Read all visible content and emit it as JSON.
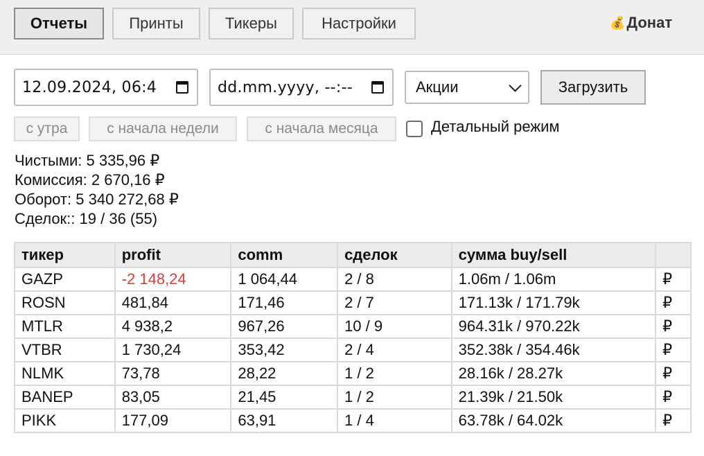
{
  "nav": {
    "tabs": [
      {
        "label": "Отчеты",
        "active": true
      },
      {
        "label": "Принты",
        "active": false
      },
      {
        "label": "Тикеры",
        "active": false
      },
      {
        "label": "Настройки",
        "active": false
      }
    ],
    "donate": {
      "icon": "money-bag-icon",
      "label": "Донат"
    }
  },
  "filters": {
    "date_from": "12.09.2024, 06:4",
    "date_to_placeholder": "dd.mm.yyyy, --:--",
    "instrument_select": "Акции",
    "load_button": "Загрузить",
    "quick_ranges": [
      "с утра",
      "с начала недели",
      "с начала месяца"
    ],
    "detailed_mode": {
      "label": "Детальный режим",
      "checked": false
    }
  },
  "summary": {
    "net_label": "Чистыми:",
    "net_value": "5 335,96 ₽",
    "commission_label": "Комиссия:",
    "commission_value": "2 670,16 ₽",
    "turnover_label": "Оборот:",
    "turnover_value": "5 340 272,68 ₽",
    "deals_label": "Сделок::",
    "deals_value": "19 / 36 (55)"
  },
  "table": {
    "headers": [
      "тикер",
      "profit",
      "comm",
      "сделок",
      "сумма buy/sell",
      ""
    ],
    "rows": [
      {
        "ticker": "GAZP",
        "profit": "-2 148,24",
        "comm": "1 064,44",
        "deals": "2 / 8",
        "sum": "1.06m / 1.06m",
        "cur": "₽",
        "negative": true
      },
      {
        "ticker": "ROSN",
        "profit": "481,84",
        "comm": "171,46",
        "deals": "2 / 7",
        "sum": "171.13k / 171.79k",
        "cur": "₽",
        "negative": false
      },
      {
        "ticker": "MTLR",
        "profit": "4 938,2",
        "comm": "967,26",
        "deals": "10 / 9",
        "sum": "964.31k / 970.22k",
        "cur": "₽",
        "negative": false
      },
      {
        "ticker": "VTBR",
        "profit": "1 730,24",
        "comm": "353,42",
        "deals": "2 / 4",
        "sum": "352.38k / 354.46k",
        "cur": "₽",
        "negative": false
      },
      {
        "ticker": "NLMK",
        "profit": "73,78",
        "comm": "28,22",
        "deals": "1 / 2",
        "sum": "28.16k / 28.27k",
        "cur": "₽",
        "negative": false
      },
      {
        "ticker": "BANEP",
        "profit": "83,05",
        "comm": "21,45",
        "deals": "1 / 2",
        "sum": "21.39k / 21.50k",
        "cur": "₽",
        "negative": false
      },
      {
        "ticker": "PIKK",
        "profit": "177,09",
        "comm": "63,91",
        "deals": "1 / 4",
        "sum": "63.78k / 64.02k",
        "cur": "₽",
        "negative": false
      }
    ]
  },
  "colors": {
    "negative": "#e53b3b",
    "header_bg": "#ebebeb",
    "topbar_bg": "#efefef"
  }
}
